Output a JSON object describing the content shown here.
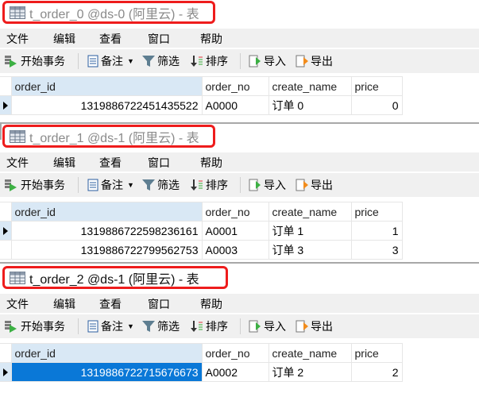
{
  "menu": [
    "文件",
    "编辑",
    "查看",
    "窗口",
    "帮助"
  ],
  "toolbar": {
    "begin_transaction": "开始事务",
    "memo": "备注",
    "filter": "筛选",
    "sort": "排序",
    "import": "导入",
    "export": "导出"
  },
  "columns": [
    "order_id",
    "order_no",
    "create_name",
    "price"
  ],
  "panels": [
    {
      "title": "t_order_0 @ds-0 (阿里云) - 表",
      "active": false,
      "rows": [
        {
          "order_id": "1319886722451435522",
          "order_no": "A0000",
          "create_name": "订单 0",
          "price": "0"
        }
      ]
    },
    {
      "title": "t_order_1 @ds-1 (阿里云) - 表",
      "active": false,
      "rows": [
        {
          "order_id": "1319886722598236161",
          "order_no": "A0001",
          "create_name": "订单 1",
          "price": "1"
        },
        {
          "order_id": "1319886722799562753",
          "order_no": "A0003",
          "create_name": "订单 3",
          "price": "3"
        }
      ]
    },
    {
      "title": "t_order_2 @ds-1 (阿里云) - 表",
      "active": true,
      "rows": [
        {
          "order_id": "1319886722715676673",
          "order_no": "A0002",
          "create_name": "订单 2",
          "price": "2"
        }
      ]
    }
  ],
  "colors": {
    "highlight_border": "#ee1c1c",
    "selection": "#0a78d7",
    "sorted_header": "#d9e8f5"
  }
}
